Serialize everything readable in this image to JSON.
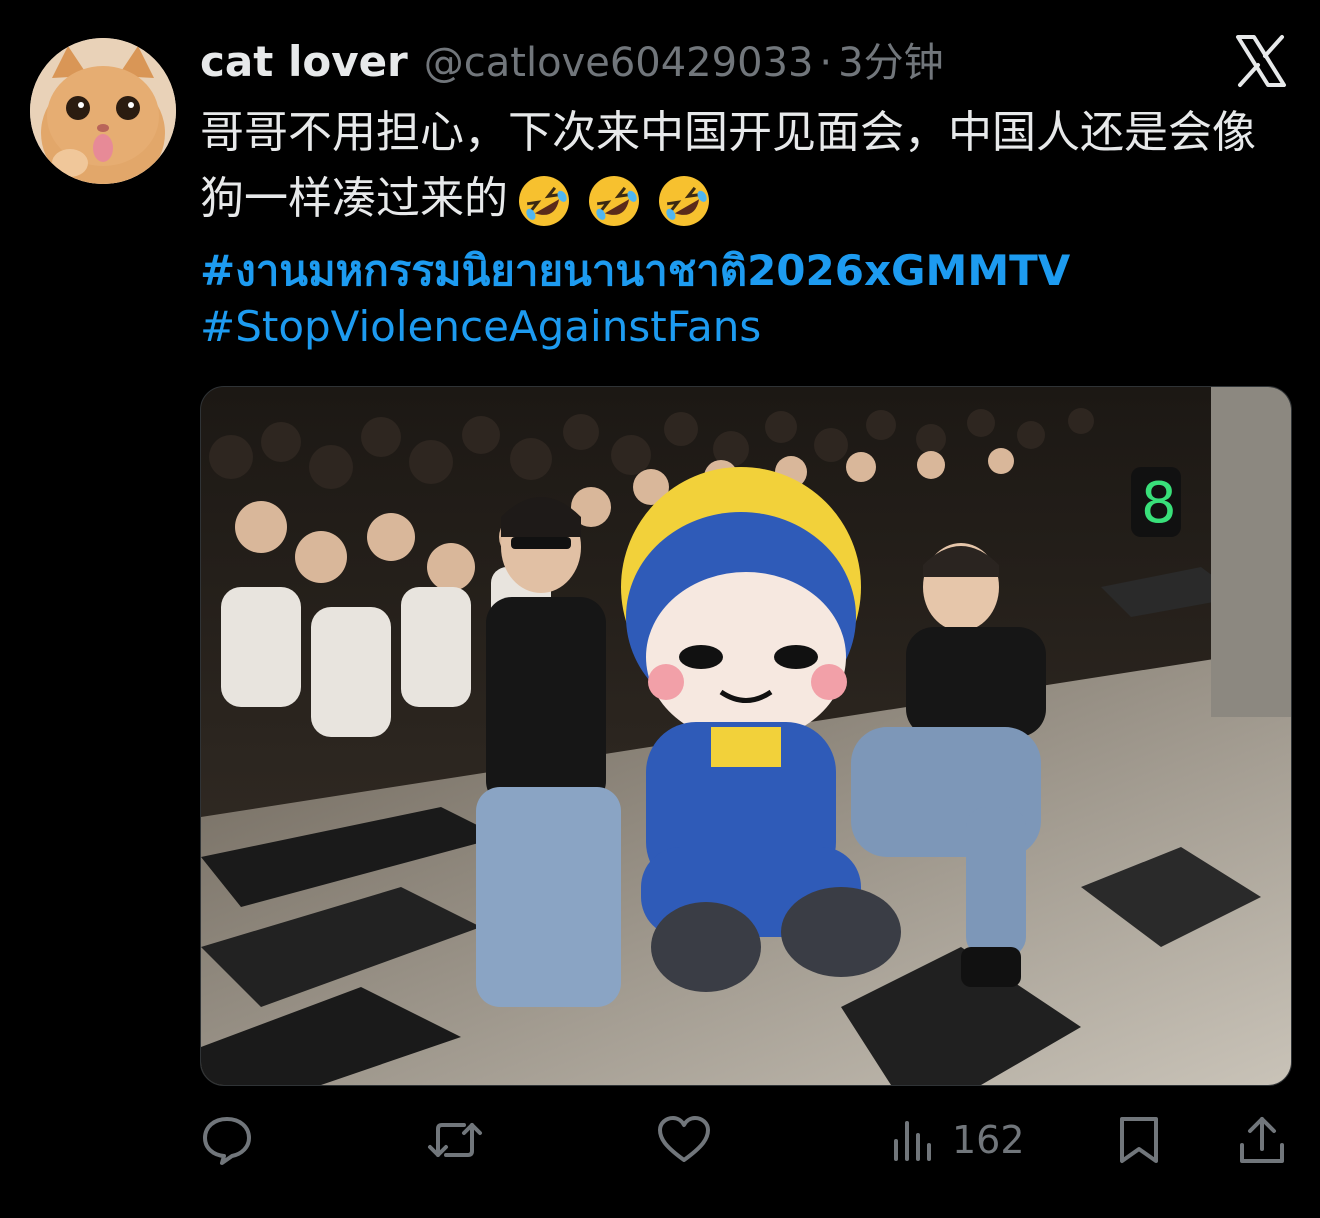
{
  "post": {
    "display_name": "cat lover",
    "handle": "@catlove60429033",
    "separator": "·",
    "time": "3分钟",
    "text": "哥哥不用担心，下次来中国开见面会，中国人还是会像狗一样凑过来的",
    "emojis": [
      "rolling-on-floor-laughing-emoji",
      "rolling-on-floor-laughing-emoji",
      "rolling-on-floor-laughing-emoji"
    ],
    "hashtags": [
      "#งานมหกรรมนิยายนานาชาติ2026xGMMTV",
      "#StopViolenceAgainstFans"
    ]
  },
  "actions": {
    "reply_icon": "speech-bubble-icon",
    "repost_icon": "repost-arrows-icon",
    "like_icon": "heart-icon",
    "views_icon": "bar-chart-icon",
    "views": "162",
    "bookmark_icon": "bookmark-icon",
    "share_icon": "share-upload-icon"
  },
  "brand": {
    "logo": "x-logo-icon"
  },
  "colors": {
    "background": "#000000",
    "text": "#e7e9ea",
    "muted": "#71767b",
    "link": "#1d9bf0"
  }
}
